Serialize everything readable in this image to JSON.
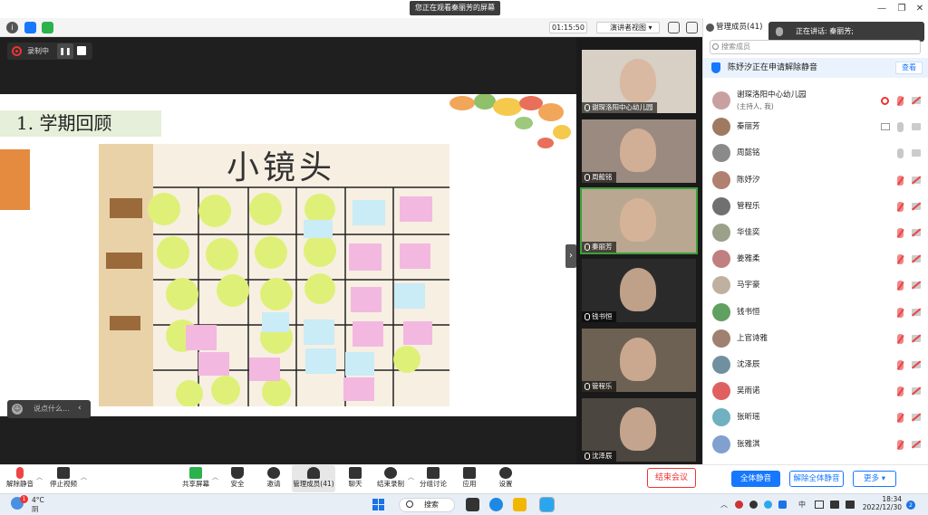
{
  "window": {
    "viewing_banner": "您正在观看秦丽芳的屏幕",
    "controls": {
      "minimize": "—",
      "restore": "❐",
      "close": "✕"
    }
  },
  "toolbar": {
    "timer": "01:15:50",
    "view_mode": "演讲者视图",
    "recording_label": "录制中"
  },
  "slide": {
    "title": "1. 学期回顾",
    "board_heading": "小镜头"
  },
  "chat": {
    "placeholder": "说点什么..."
  },
  "video_tiles": [
    {
      "name": "谢琛洛阳中心幼儿园",
      "bg": "#d8cfc5",
      "active": false
    },
    {
      "name": "周懿铭",
      "bg": "#9a8a80",
      "active": false
    },
    {
      "name": "秦丽芳",
      "bg": "#b9a792",
      "active": true
    },
    {
      "name": "钱书恒",
      "bg": "#2a2a2a",
      "active": false
    },
    {
      "name": "管程乐",
      "bg": "#6d6154",
      "active": false
    },
    {
      "name": "沈泽辰",
      "bg": "#4c4640",
      "active": false
    }
  ],
  "panel": {
    "title": "管理成员(41)",
    "speaking": "正在讲话: 秦丽芳;",
    "search_placeholder": "搜索成员",
    "request_text": "陈妤汐正在申请解除静音",
    "request_button": "查看",
    "members": [
      {
        "name": "谢琛洛阳中心幼儿园",
        "sub": "(主持人, 我)",
        "avatar": "#c9a0a0",
        "mic": "off",
        "cam": "off"
      },
      {
        "name": "秦丽芳",
        "sub": "",
        "avatar": "#a07a60",
        "mic": "on",
        "cam": "on"
      },
      {
        "name": "周懿铭",
        "sub": "",
        "avatar": "#8a8a8a",
        "mic": "on",
        "cam": "on"
      },
      {
        "name": "陈妤汐",
        "sub": "",
        "avatar": "#b08070",
        "mic": "off",
        "cam": "off"
      },
      {
        "name": "管程乐",
        "sub": "",
        "avatar": "#707070",
        "mic": "off",
        "cam": "off"
      },
      {
        "name": "华佳奕",
        "sub": "",
        "avatar": "#9aa08a",
        "mic": "off",
        "cam": "off"
      },
      {
        "name": "姜雅柔",
        "sub": "",
        "avatar": "#c08080",
        "mic": "off",
        "cam": "off"
      },
      {
        "name": "马宇豪",
        "sub": "",
        "avatar": "#c0b0a0",
        "mic": "off",
        "cam": "off"
      },
      {
        "name": "钱书恒",
        "sub": "",
        "avatar": "#60a060",
        "mic": "off",
        "cam": "off"
      },
      {
        "name": "上官诗雅",
        "sub": "",
        "avatar": "#a08070",
        "mic": "off",
        "cam": "off"
      },
      {
        "name": "沈泽辰",
        "sub": "",
        "avatar": "#7090a0",
        "mic": "off",
        "cam": "off"
      },
      {
        "name": "吴雨诺",
        "sub": "",
        "avatar": "#e06060",
        "mic": "off",
        "cam": "off"
      },
      {
        "name": "张昕瑶",
        "sub": "",
        "avatar": "#70b0c0",
        "mic": "off",
        "cam": "off"
      },
      {
        "name": "张雅淇",
        "sub": "",
        "avatar": "#80a0d0",
        "mic": "off",
        "cam": "off"
      }
    ],
    "mute_all": "全体静音",
    "unmute_all": "解除全体静音",
    "more": "更多 ▾"
  },
  "bottom_toolbar": {
    "unmute": "解除静音",
    "stop_video": "停止视频",
    "share_screen": "共享屏幕",
    "security": "安全",
    "invite": "邀请",
    "manage_members": "管理成员(41)",
    "chat": "聊天",
    "end_recording": "结束录制",
    "breakout": "分组讨论",
    "apps": "应用",
    "settings": "设置",
    "end_meeting": "结束会议"
  },
  "taskbar": {
    "temperature": "4°C",
    "condition": "阴",
    "weather_badge": "1",
    "search": "搜索",
    "ime": "中",
    "time": "18:34",
    "date": "2022/12/30",
    "notifications": "2"
  }
}
